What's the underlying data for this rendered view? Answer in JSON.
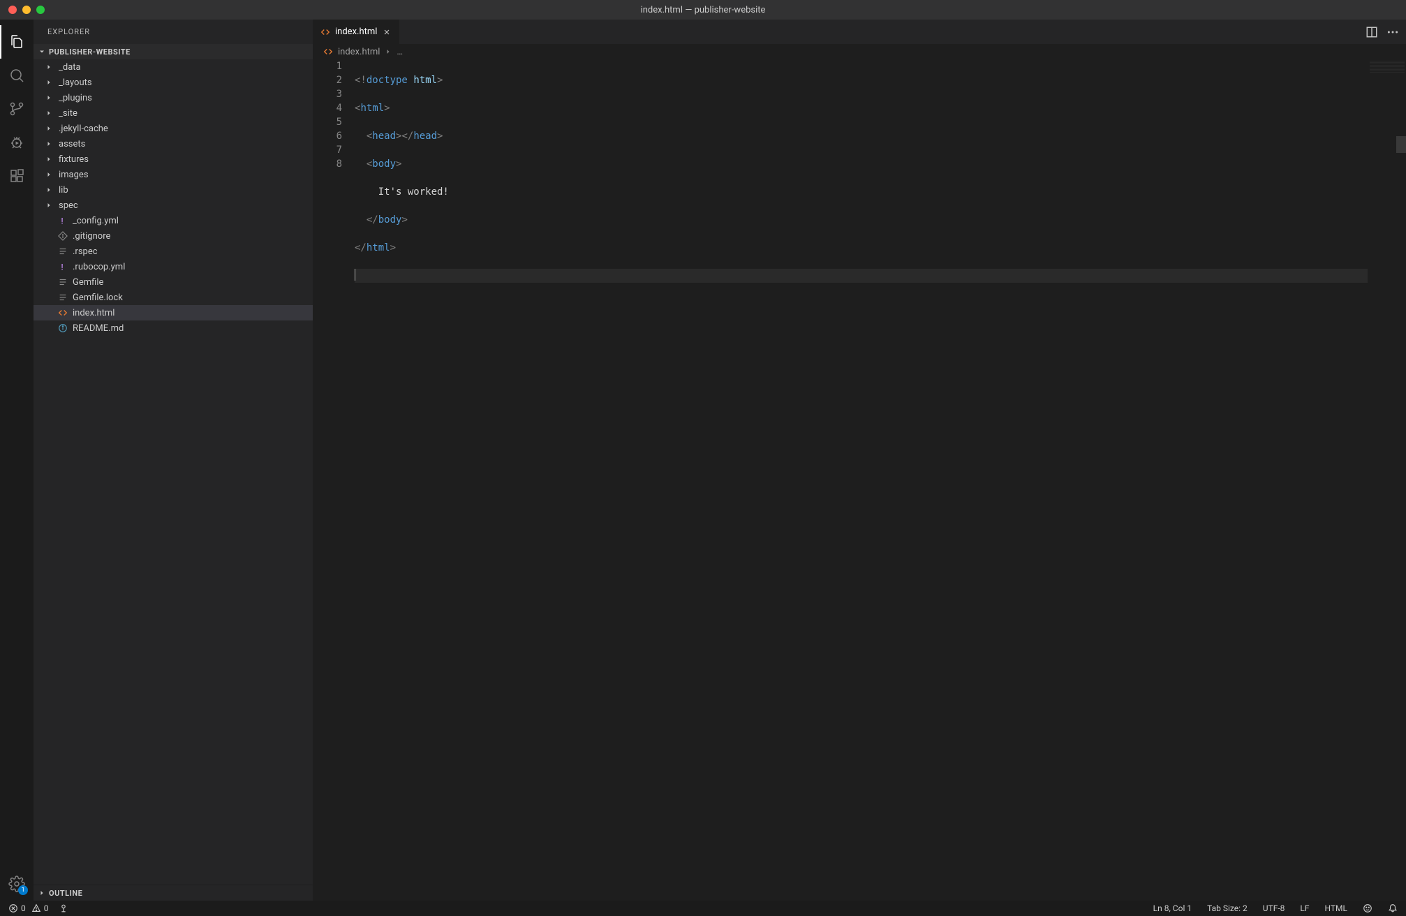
{
  "window": {
    "title": "index.html — publisher-website"
  },
  "activity_bar": {
    "settings_badge": "1"
  },
  "sidebar": {
    "title": "EXPLORER",
    "project": "PUBLISHER-WEBSITE",
    "outline_label": "OUTLINE",
    "items": [
      {
        "label": "_data",
        "type": "folder"
      },
      {
        "label": "_layouts",
        "type": "folder"
      },
      {
        "label": "_plugins",
        "type": "folder"
      },
      {
        "label": "_site",
        "type": "folder"
      },
      {
        "label": ".jekyll-cache",
        "type": "folder"
      },
      {
        "label": "assets",
        "type": "folder"
      },
      {
        "label": "fixtures",
        "type": "folder"
      },
      {
        "label": "images",
        "type": "folder"
      },
      {
        "label": "lib",
        "type": "folder"
      },
      {
        "label": "spec",
        "type": "folder"
      },
      {
        "label": "_config.yml",
        "type": "yaml"
      },
      {
        "label": ".gitignore",
        "type": "git"
      },
      {
        "label": ".rspec",
        "type": "text"
      },
      {
        "label": ".rubocop.yml",
        "type": "yaml"
      },
      {
        "label": "Gemfile",
        "type": "text"
      },
      {
        "label": "Gemfile.lock",
        "type": "text"
      },
      {
        "label": "index.html",
        "type": "html",
        "selected": true
      },
      {
        "label": "README.md",
        "type": "info"
      }
    ]
  },
  "tab": {
    "label": "index.html"
  },
  "breadcrumb": {
    "file": "index.html",
    "ellipsis": "…"
  },
  "editor": {
    "lines": [
      "1",
      "2",
      "3",
      "4",
      "5",
      "6",
      "7",
      "8"
    ],
    "tokens": {
      "doctype": "doctype",
      "html_attr": "html",
      "html": "html",
      "head": "head",
      "body": "body",
      "text_line5": "    It's worked!"
    }
  },
  "statusbar": {
    "errors": "0",
    "warnings": "0",
    "ln_col": "Ln 8, Col 1",
    "tab_size": "Tab Size: 2",
    "encoding": "UTF-8",
    "eol": "LF",
    "language": "HTML"
  }
}
